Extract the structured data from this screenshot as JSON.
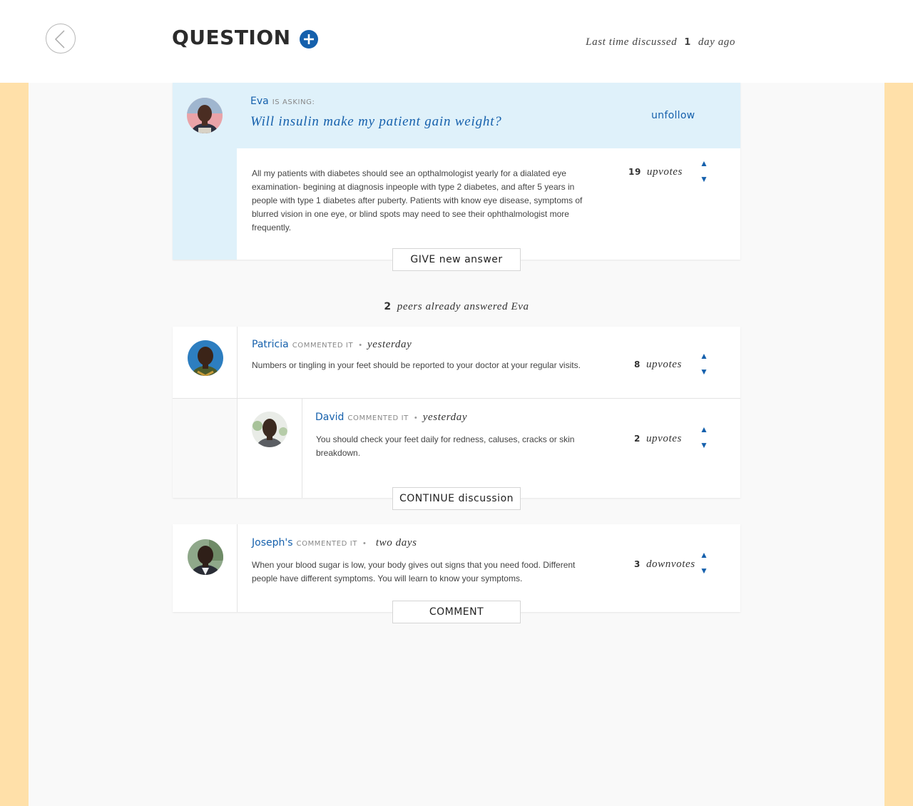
{
  "header": {
    "title": "QUESTION",
    "last_discussed_prefix": "Last time discussed",
    "last_discussed_value": "1",
    "last_discussed_suffix": "day ago"
  },
  "question": {
    "author": "Eva",
    "tag": "IS ASKING:",
    "title": "Will insulin make my patient gain weight?",
    "follow_label": "unfollow",
    "body": "All my patients with diabetes should see an opthalmologist yearly for a dialated eye examination- begining at diagnosis inpeople with type 2 diabetes, and after 5 years in people with type 1 diabetes after puberty. Patients with know eye disease, symptoms of blurred vision in one eye, or blind spots may need to see their ophthalmologist more frequently.",
    "votes": "19",
    "votes_label": "upvotes",
    "action_label": "GIVE new answer"
  },
  "peers": {
    "count": "2",
    "text": "peers already answered Eva"
  },
  "answers": [
    {
      "author": "Patricia",
      "tag": "COMMENTED IT",
      "when": "yesterday",
      "body": "Numbers or tingling in your feet should be reported to your doctor at your regular visits.",
      "votes": "8",
      "votes_label": "upvotes",
      "reply": {
        "author": "David",
        "tag": "COMMENTED IT",
        "when": "yesterday",
        "body": "You should check your feet daily for redness, caluses, cracks or skin breakdown.",
        "votes": "2",
        "votes_label": "upvotes"
      },
      "action_label": "CONTINUE discussion"
    },
    {
      "author": "Joseph's",
      "tag": "COMMENTED IT",
      "when": "two days",
      "body": "When your blood sugar is low, your body gives out signs that you need food. Different people have different symptoms. You will learn to know your symptoms.",
      "votes": "3",
      "votes_label": "downvotes",
      "action_label": "COMMENT"
    }
  ],
  "icons": {
    "back": "chevron-left-circle-icon",
    "add": "plus-circle-icon",
    "upvote": "triangle-up-icon",
    "downvote": "triangle-down-icon"
  },
  "colors": {
    "accent": "#1560ac",
    "question_bg": "#dff1fa",
    "side_bg": "#ffe0a9",
    "panel_bg": "#f9f9f9"
  },
  "glyphs": {
    "up": "▲",
    "down": "▼",
    "dot": "•"
  }
}
